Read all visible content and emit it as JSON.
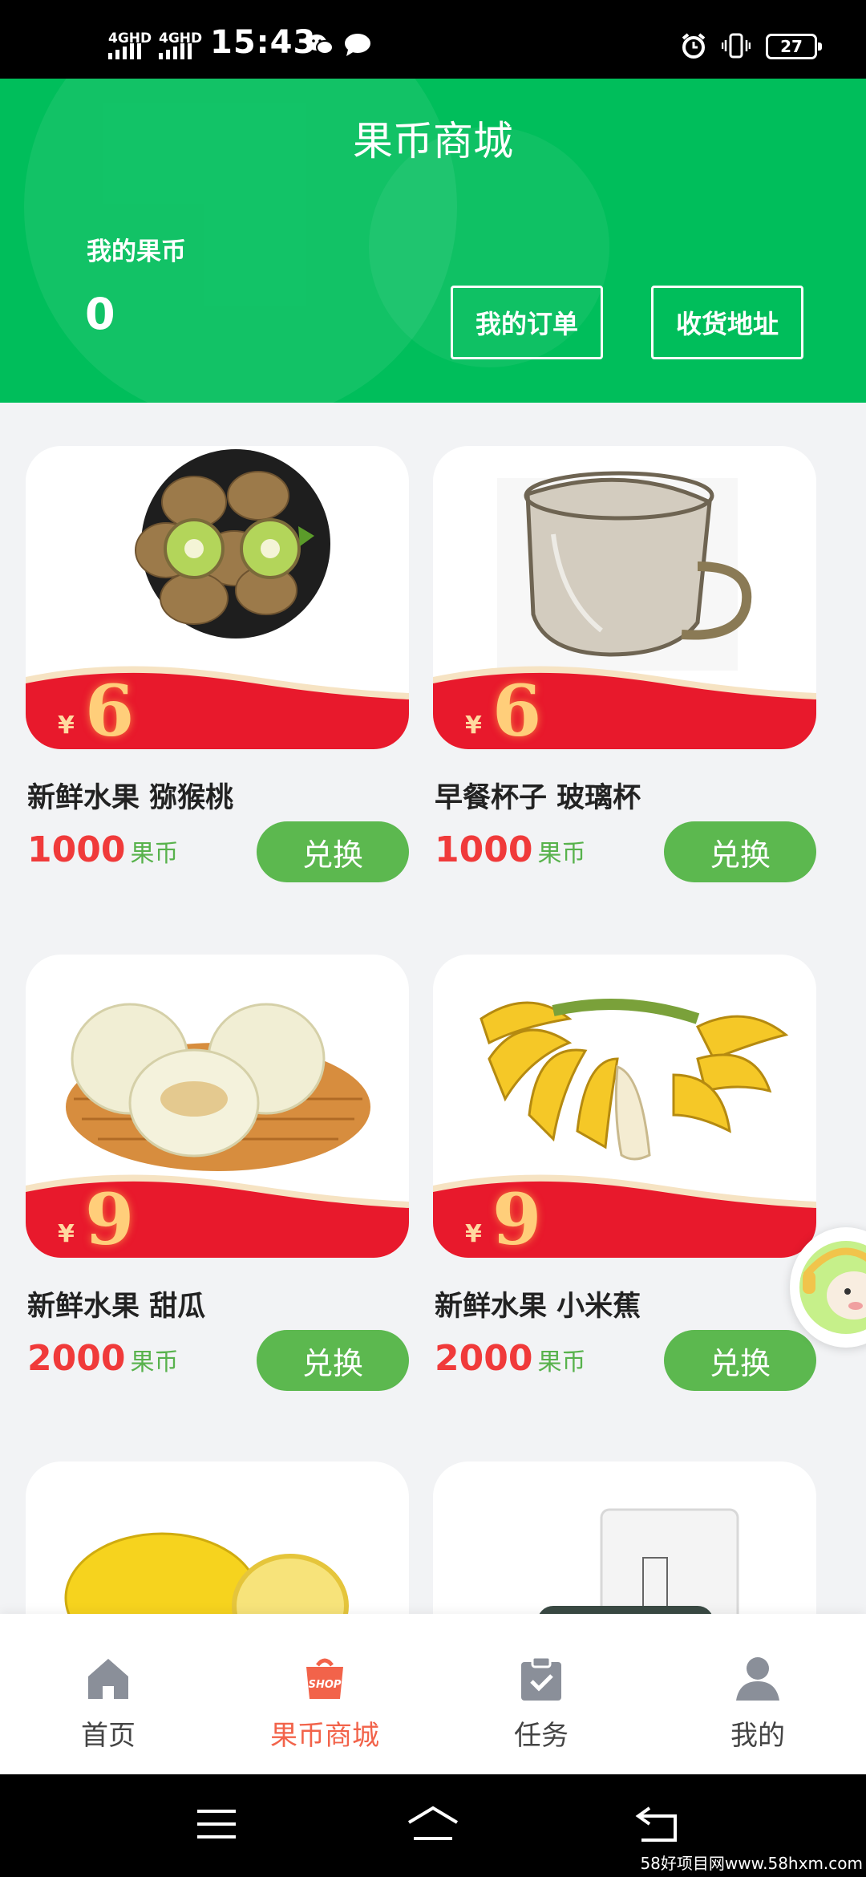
{
  "status_bar": {
    "signal_1": "4GHD",
    "signal_2": "4GHD",
    "time": "15:43",
    "battery": "27"
  },
  "header": {
    "title": "果币商城",
    "coins_label": "我的果币",
    "coins_value": "0",
    "orders_button": "我的订单",
    "address_button": "收货地址"
  },
  "products": [
    {
      "title": "新鲜水果 猕猴桃",
      "price_yen": "¥",
      "price": "6",
      "cost": "1000",
      "unit": "果币",
      "button": "兑换",
      "image": "kiwi-fruit-image"
    },
    {
      "title": "早餐杯子 玻璃杯",
      "price_yen": "¥",
      "price": "6",
      "cost": "1000",
      "unit": "果币",
      "button": "兑换",
      "image": "glass-cup-image"
    },
    {
      "title": "新鲜水果 甜瓜",
      "price_yen": "¥",
      "price": "9",
      "cost": "2000",
      "unit": "果币",
      "button": "兑换",
      "image": "melon-image"
    },
    {
      "title": "新鲜水果 小米蕉",
      "price_yen": "¥",
      "price": "9",
      "cost": "2000",
      "unit": "果币",
      "button": "兑换",
      "image": "banana-image"
    },
    {
      "image": "lemon-image"
    },
    {
      "image": "packaged-product-image"
    }
  ],
  "bottom_nav": {
    "home": "首页",
    "shop": "果币商城",
    "tasks": "任务",
    "mine": "我的",
    "active": "shop"
  },
  "watermark": "58好项目网www.58hxm.com",
  "colors": {
    "brand_green": "#00be5b",
    "button_green": "#5cb84f",
    "price_red": "#f03a3a",
    "active_orange": "#f2634a"
  }
}
